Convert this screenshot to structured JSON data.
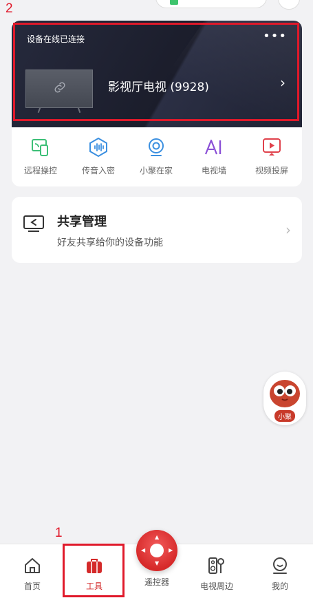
{
  "annotations": {
    "label_1": "1",
    "label_2": "2"
  },
  "device_card": {
    "status": "设备在线已连接",
    "more": "•••",
    "device_name": "影视厅电视 (9928)"
  },
  "tools": [
    {
      "label": "远程操控",
      "icon": "remote-control-icon",
      "color": "#3cbf77"
    },
    {
      "label": "传音入密",
      "icon": "voice-wave-icon",
      "color": "#3a8fe0"
    },
    {
      "label": "小聚在家",
      "icon": "camera-icon",
      "color": "#3a8fe0"
    },
    {
      "label": "电视墙",
      "icon": "ai-icon",
      "color": "#8a4fd6"
    },
    {
      "label": "视频投屏",
      "icon": "video-cast-icon",
      "color": "#e0414b"
    }
  ],
  "share": {
    "title": "共享管理",
    "subtitle": "好友共享给你的设备功能"
  },
  "mascot": {
    "label": "小聚"
  },
  "tabbar": {
    "home": "首页",
    "tools": "工具",
    "remote": "遥控器",
    "tv_peripheral": "电视周边",
    "mine": "我的"
  },
  "colors": {
    "accent": "#d42a2a",
    "annotation": "#e0192a"
  }
}
